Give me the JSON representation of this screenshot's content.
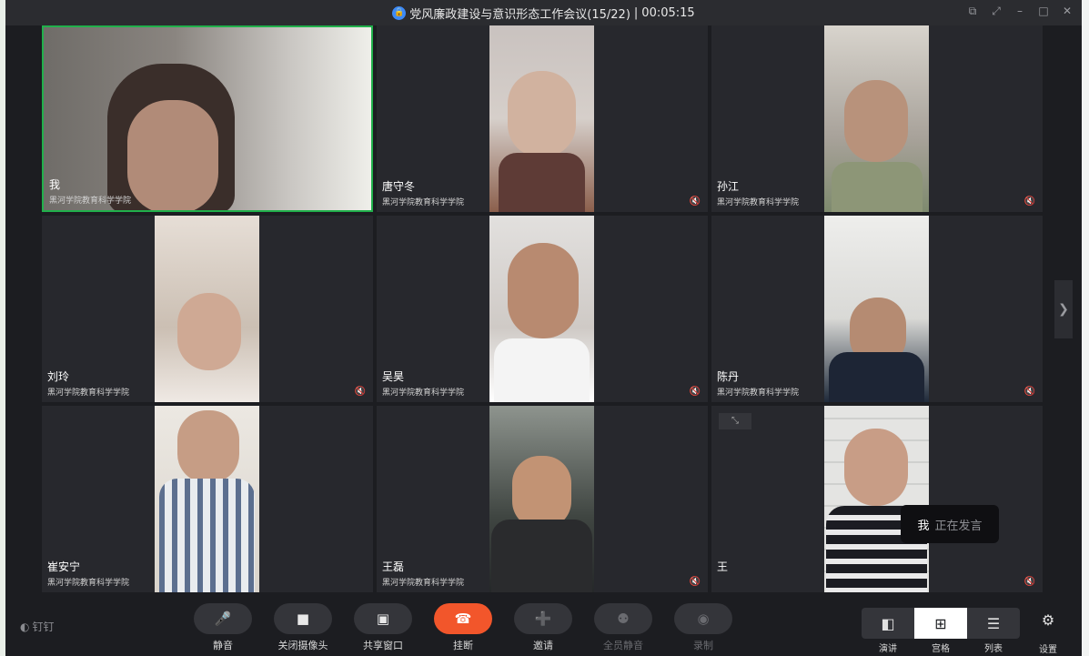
{
  "window": {
    "title": "党风廉政建设与意识形态工作会议(15/22)",
    "separator": "|",
    "timer": "00:05:15"
  },
  "participants": [
    {
      "name": "我",
      "org": "黑河学院教育科学学院",
      "muted": false,
      "active": true
    },
    {
      "name": "唐守冬",
      "org": "黑河学院教育科学学院",
      "muted": true
    },
    {
      "name": "孙江",
      "org": "黑河学院教育科学学院",
      "muted": true
    },
    {
      "name": "刘玲",
      "org": "黑河学院教育科学学院",
      "muted": true
    },
    {
      "name": "吴昊",
      "org": "黑河学院教育科学学院",
      "muted": true
    },
    {
      "name": "陈丹",
      "org": "黑河学院教育科学学院",
      "muted": true
    },
    {
      "name": "崔安宁",
      "org": "黑河学院教育科学学院",
      "muted": false
    },
    {
      "name": "王磊",
      "org": "黑河学院教育科学学院",
      "muted": true
    },
    {
      "name": "王",
      "org": "",
      "muted": true
    }
  ],
  "speaking": {
    "who": "我",
    "status": "正在发言"
  },
  "toolbar": {
    "pin_label": "钉钉",
    "mute": "静音",
    "camera_off": "关闭摄像头",
    "share": "共享窗口",
    "hangup": "挂断",
    "invite": "邀请",
    "mute_all": "全员静音",
    "record": "录制",
    "view_speaker": "演讲",
    "view_grid": "宫格",
    "view_list": "列表",
    "settings": "设置"
  },
  "colors": {
    "active_border": "#21b04b",
    "hangup": "#f2562b",
    "lock_badge": "#3d8af7"
  }
}
